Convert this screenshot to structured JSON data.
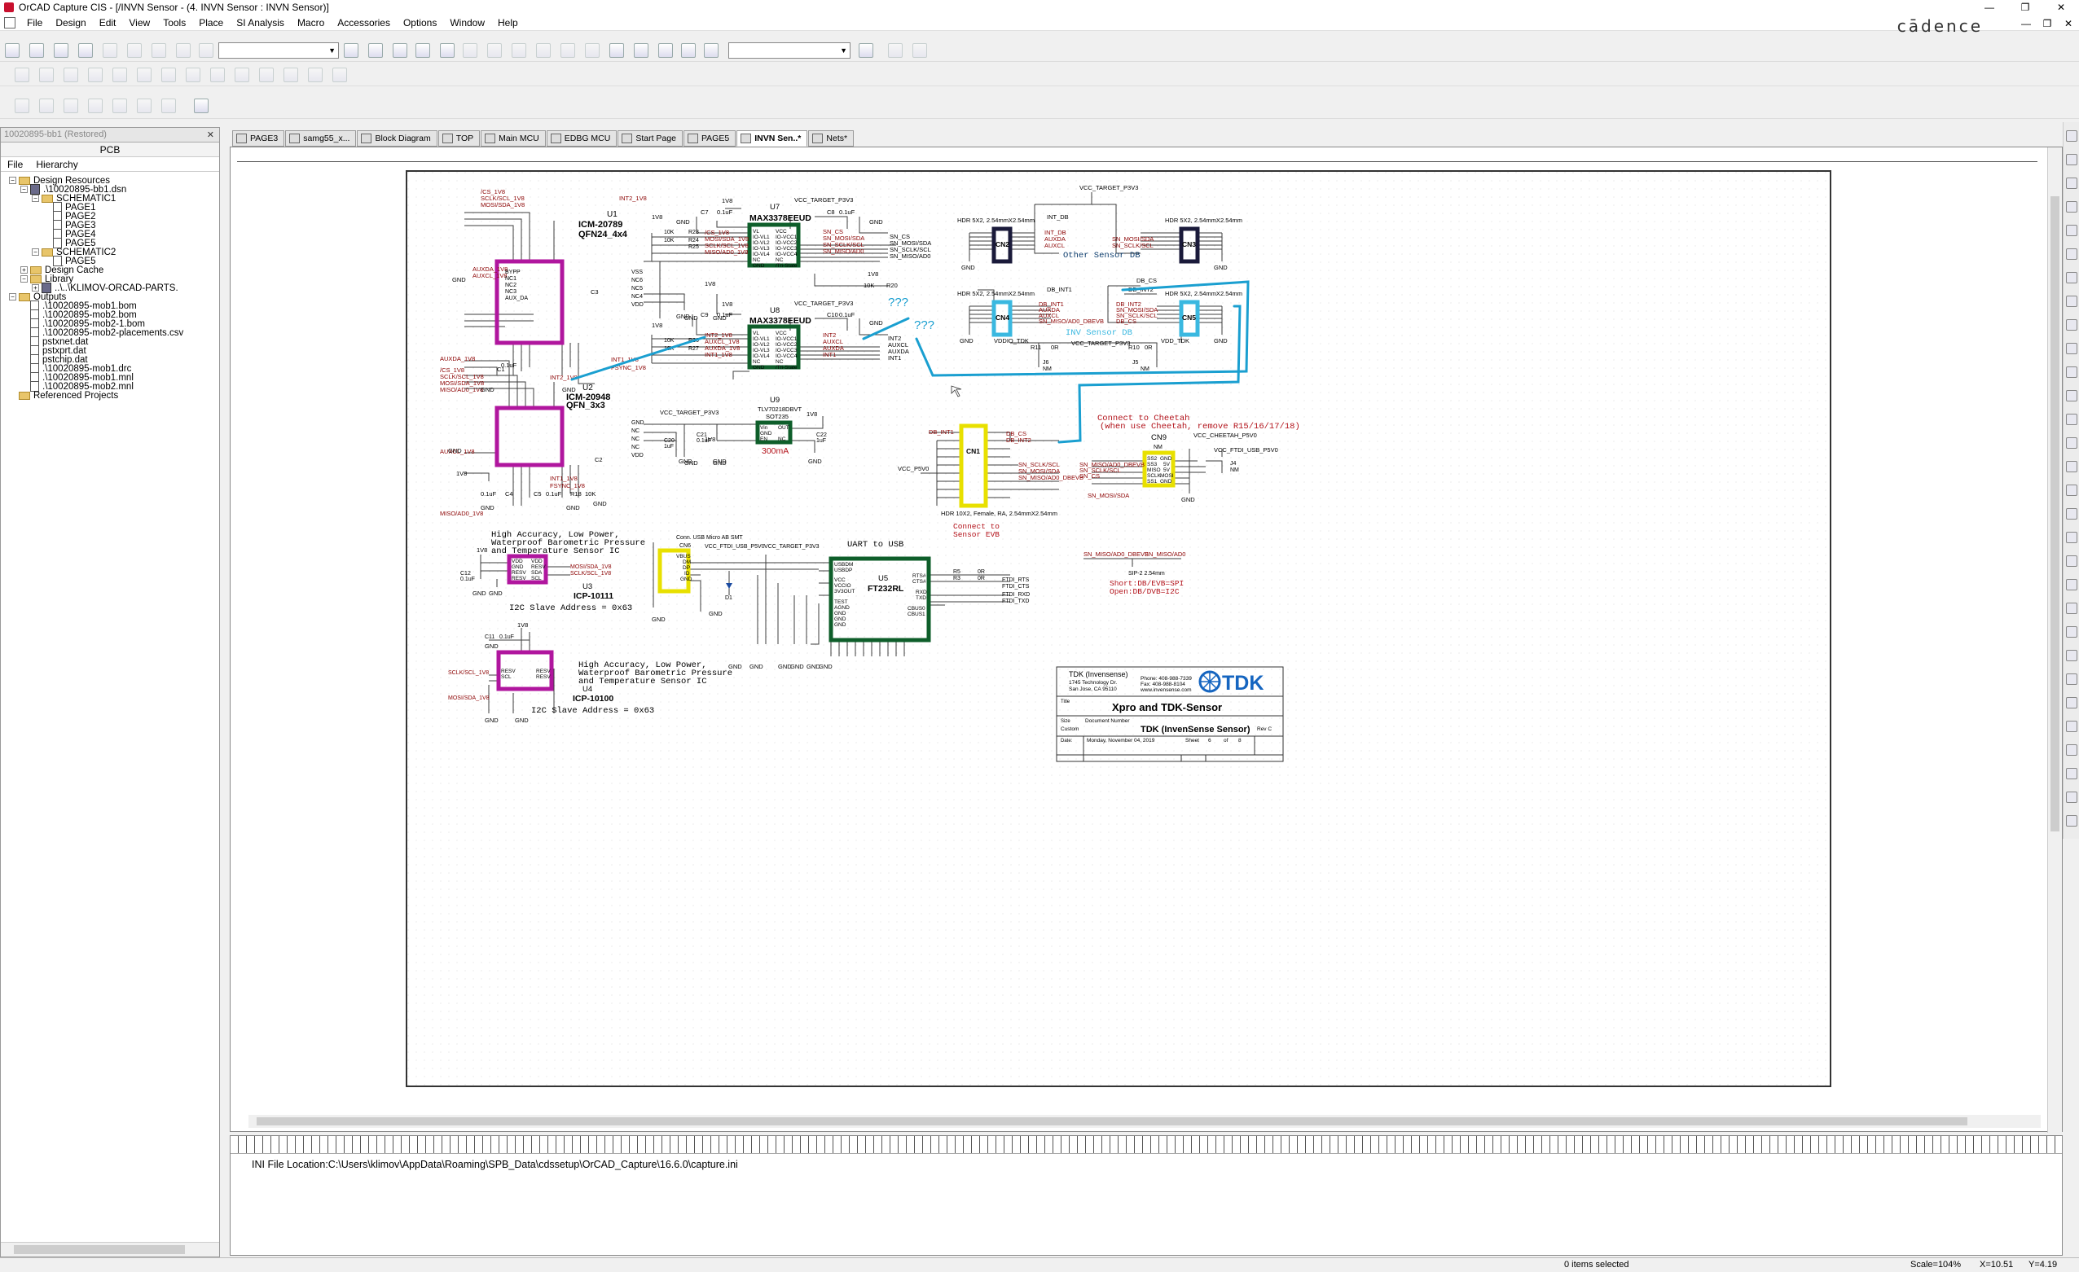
{
  "window": {
    "title": "OrCAD Capture CIS - [/INVN Sensor - (4. INVN Sensor : INVN Sensor)]",
    "brand": "cādence"
  },
  "menu": [
    "File",
    "Design",
    "Edit",
    "View",
    "Tools",
    "Place",
    "SI Analysis",
    "Macro",
    "Accessories",
    "Options",
    "Window",
    "Help"
  ],
  "project": {
    "title": "10020895-bb1 (Restored)",
    "sub": "PCB",
    "tabs": [
      "File",
      "Hierarchy"
    ],
    "tree": [
      {
        "label": "Design Resources",
        "level": 0,
        "icon": "folder-icon",
        "exp": "−"
      },
      {
        "label": ".\\10020895-bb1.dsn",
        "level": 1,
        "icon": "design-icon",
        "exp": "−"
      },
      {
        "label": "SCHEMATIC1",
        "level": 2,
        "icon": "folder-icon",
        "exp": "−"
      },
      {
        "label": "PAGE1",
        "level": 3,
        "icon": "page-icon"
      },
      {
        "label": "PAGE2",
        "level": 3,
        "icon": "page-icon"
      },
      {
        "label": "PAGE3",
        "level": 3,
        "icon": "page-icon"
      },
      {
        "label": "PAGE4",
        "level": 3,
        "icon": "page-icon"
      },
      {
        "label": "PAGE5",
        "level": 3,
        "icon": "page-icon"
      },
      {
        "label": "SCHEMATIC2",
        "level": 2,
        "icon": "folder-icon",
        "exp": "−"
      },
      {
        "label": "PAGE5",
        "level": 3,
        "icon": "page-icon"
      },
      {
        "label": "Design Cache",
        "level": 1,
        "icon": "folder-icon",
        "exp": "+"
      },
      {
        "label": "Library",
        "level": 1,
        "icon": "folder-icon",
        "exp": "−"
      },
      {
        "label": "..\\..\\KLIMOV-ORCAD-PARTS.",
        "level": 2,
        "icon": "library-icon",
        "exp": "+"
      },
      {
        "label": "Outputs",
        "level": 0,
        "icon": "folder-icon",
        "exp": "−"
      },
      {
        "label": ".\\10020895-mob1.bom",
        "level": 1,
        "icon": "page-icon"
      },
      {
        "label": ".\\10020895-mob2.bom",
        "level": 1,
        "icon": "page-icon"
      },
      {
        "label": ".\\10020895-mob2-1.bom",
        "level": 1,
        "icon": "page-icon"
      },
      {
        "label": ".\\10020895-mob2-placements.csv",
        "level": 1,
        "icon": "page-icon"
      },
      {
        "label": "pstxnet.dat",
        "level": 1,
        "icon": "page-icon"
      },
      {
        "label": "pstxprt.dat",
        "level": 1,
        "icon": "page-icon"
      },
      {
        "label": "pstchip.dat",
        "level": 1,
        "icon": "page-icon"
      },
      {
        "label": ".\\10020895-mob1.drc",
        "level": 1,
        "icon": "page-icon"
      },
      {
        "label": ".\\10020895-mob1.mnl",
        "level": 1,
        "icon": "page-icon"
      },
      {
        "label": ".\\10020895-mob2.mnl",
        "level": 1,
        "icon": "page-icon"
      },
      {
        "label": "Referenced Projects",
        "level": 0,
        "icon": "folder-icon"
      }
    ]
  },
  "doc_tabs": [
    "PAGE3",
    "samg55_x...",
    "Block Diagram",
    "TOP",
    "Main MCU",
    "EDBG MCU",
    "Start Page",
    "PAGE5",
    "INVN Sen..*",
    "Nets*"
  ],
  "active_tab": 8,
  "schematic": {
    "u1": {
      "ref": "U1",
      "part": "ICM-20789",
      "pkg": "QFN24_4x4"
    },
    "u2": {
      "ref": "U2",
      "part": "ICM-20948",
      "pkg": "QFN_3x3"
    },
    "u3": {
      "ref": "U3",
      "part": "ICP-10111",
      "desc": [
        "High Accuracy, Low Power,",
        "Waterproof Barometric Pressure",
        "and Temperature Sensor IC"
      ],
      "addr": "I2C Slave Address = 0x63"
    },
    "u4": {
      "ref": "U4",
      "part": "ICP-10100",
      "desc": [
        "High Accuracy, Low Power,",
        "Waterproof Barometric Pressure",
        "and Temperature Sensor IC"
      ],
      "addr": "I2C Slave Address = 0x63"
    },
    "u5": {
      "ref": "U5",
      "part": "FT232RL",
      "label": "UART to USB"
    },
    "u7": {
      "ref": "U7",
      "part": "MAX3378EEUD"
    },
    "u8": {
      "ref": "U8",
      "part": "MAX3378EEUD"
    },
    "u9": {
      "ref": "U9",
      "part": "TLV70218DBVT",
      "pkg": "SOT235",
      "note": "300mA"
    },
    "cn1": {
      "ref": "CN1",
      "hdr": "HDR 10X2, Female, RA, 2.54mmX2.54mm",
      "note": [
        "Connect to",
        "Sensor EVB"
      ]
    },
    "cn2": {
      "ref": "CN2",
      "hdr": "HDR 5X2, 2.54mmX2.54mm"
    },
    "cn3": {
      "ref": "CN3",
      "hdr": "HDR 5X2, 2.54mmX2.54mm"
    },
    "cn4": {
      "ref": "CN4",
      "hdr": "HDR 5X2, 2.54mmX2.54mm"
    },
    "cn5": {
      "ref": "CN5",
      "hdr": "HDR 5X2, 2.54mmX2.54mm"
    },
    "cn6": {
      "ref": "CN6",
      "desc": "Conn. USB Micro AB SMT"
    },
    "cn9": {
      "ref": "CN9",
      "nm": "NM"
    },
    "other_db": "Other Sensor DB",
    "invn_db": "INV Sensor DB",
    "cheetah_note": [
      "Connect to Cheetah",
      "(when use Cheetah, remove R15/16/17/18)"
    ],
    "short_note": [
      "Short:DB/EVB=SPI",
      "Open:DB/DVB=I2C"
    ],
    "question": "???",
    "nets": {
      "vcc_target": "VCC_TARGET_P3V3",
      "vcc_ftdi": "VCC_FTDI_USB_P5V0",
      "vcc_cheetah": "VCC_CHEETAH_P5V0",
      "vcc_p5v0": "VCC_P5V0",
      "v1v8": "1V8",
      "gnd": "GND"
    },
    "title_block": {
      "company": "TDK (Invensense)",
      "addr1": "1745 Technology Dr.",
      "addr2": "San Jose, CA 95110",
      "phone": "Phone: 408-988-7339",
      "fax": "Fax: 408-988-8104",
      "web": "www.invensense.com",
      "logo": "TDK",
      "title_label": "Title",
      "title": "Xpro and TDK-Sensor",
      "size_label": "Size",
      "size": "Custom",
      "docnum_label": "Document Number",
      "docnum": "TDK (InvenSense Sensor)",
      "rev": "Rev C",
      "date_label": "Date:",
      "date": "Monday, November 04, 2019",
      "sheet_label": "Sheet",
      "sheet": "6",
      "of_label": "of",
      "of": "8"
    }
  },
  "session_log": "INI File Location:C:\\Users\\klimov\\AppData\\Roaming\\SPB_Data\\cdssetup\\OrCAD_Capture\\16.6.0\\capture.ini",
  "status": {
    "selected": "0 items selected",
    "scale": "Scale=104%",
    "x": "X=10.51",
    "y": "Y=4.19"
  },
  "colors": {
    "part": "#b0169e",
    "buffer": "#0e5e2a",
    "conn_yellow": "#e8e000",
    "conn_navy": "#1a1a3a",
    "conn_cyan": "#3ab8e0",
    "wire": "#3d3d3d",
    "net": "#8b0000",
    "annotation": "#1a9fd0",
    "brand": "#c8102e",
    "tdk": "#1565c0"
  }
}
